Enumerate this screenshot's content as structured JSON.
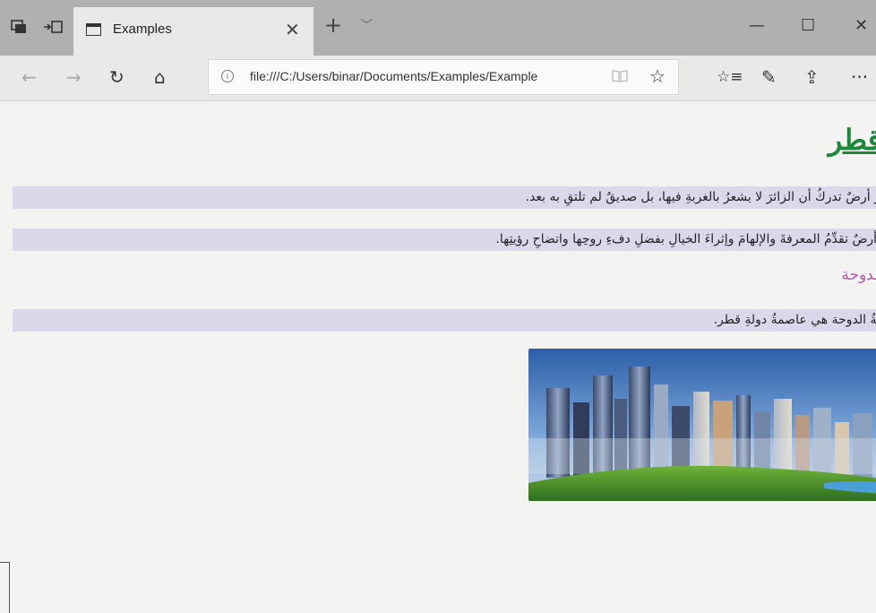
{
  "browser": {
    "tab": {
      "title": "Examples",
      "close": "✕"
    },
    "new_tab": "+",
    "tab_dropdown": "﹀",
    "window": {
      "minimize": "—",
      "maximize": "☐",
      "close": "✕"
    },
    "address": {
      "url": "file:///C:/Users/binar/Documents/Examples/Example",
      "info": "i"
    },
    "nav": {
      "back": "←",
      "forward": "→",
      "refresh": "↻",
      "home": "⌂",
      "favorite": "☆",
      "favorites_list": "☆≡",
      "pen": "✎",
      "share": "⇪",
      "more": "···"
    },
    "icons": [
      "tab-set-aside-icon",
      "tabs-preview-icon",
      "tab-page-icon",
      "close-icon",
      "new-tab-icon",
      "chevron-down-icon",
      "minimize-icon",
      "maximize-icon",
      "close-window-icon",
      "back-arrow-icon",
      "forward-arrow-icon",
      "refresh-icon",
      "home-icon",
      "info-icon",
      "reading-view-icon",
      "star-icon",
      "favorites-icon",
      "pen-icon",
      "share-icon",
      "more-icon"
    ]
  },
  "page": {
    "heading": "قطر",
    "paragraphs": [
      "قطر أرضٌ تدركُ أن الزائرَ لا يشعرُ بالغربةِ فيها، بل صديقٌ لم تلتقِ به بعد.",
      "إنها أرضٌ تقدِّمُ المعرفةَ والإلهامَ وإثراءَ الخيالِ بفضلِ دفءِ روحِها واتضاحِ رؤيتِها.",
      "مدينةُ الدوحة هي عاصمةُ دولةِ قطر."
    ],
    "subheading": "الدوحة"
  },
  "colors": {
    "heading": "#1a8a3a",
    "subheading": "#b45aaa",
    "paragraph_bg": "#dcd8ec",
    "titlebar": "#b0b0ae",
    "toolbar": "#e9e9e8"
  }
}
